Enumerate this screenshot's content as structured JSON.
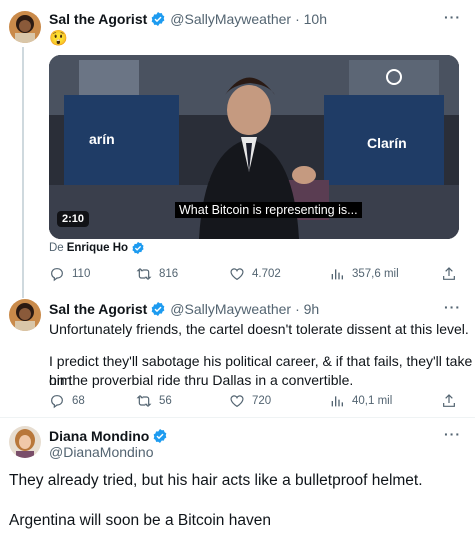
{
  "tweet1": {
    "name": "Sal the Agorist",
    "handle": "@SallyMayweather",
    "time": "· 10h",
    "text": "😲",
    "video": {
      "duration": "2:10",
      "caption": "What Bitcoin is representing is...",
      "brand_left": "arín",
      "brand_right": "Clarín"
    },
    "attribution_prefix": "De",
    "attribution_name": "Enrique Ho",
    "actions": {
      "replies": "110",
      "retweets": "816",
      "likes": "4.702",
      "views": "357,6 mil"
    }
  },
  "tweet2": {
    "name": "Sal the Agorist",
    "handle": "@SallyMayweather",
    "time": "· 9h",
    "line1": "Unfortunately friends, the cartel doesn't tolerate dissent at this level.",
    "line2": "I predict they'll sabotage his political career, & if that fails, they'll take him",
    "line3": "on the proverbial ride thru Dallas in a convertible.",
    "actions": {
      "replies": "68",
      "retweets": "56",
      "likes": "720",
      "views": "40,1 mil"
    }
  },
  "tweet3": {
    "name": "Diana Mondino",
    "handle": "@DianaMondino",
    "line1": "They already tried, but his hair acts like a bulletproof helmet.",
    "line2": "Argentina will soon be a Bitcoin haven"
  },
  "more_label": "···",
  "colors": {
    "verified": "#1d9bf0",
    "text": "#0f1419",
    "muted": "#536471"
  }
}
